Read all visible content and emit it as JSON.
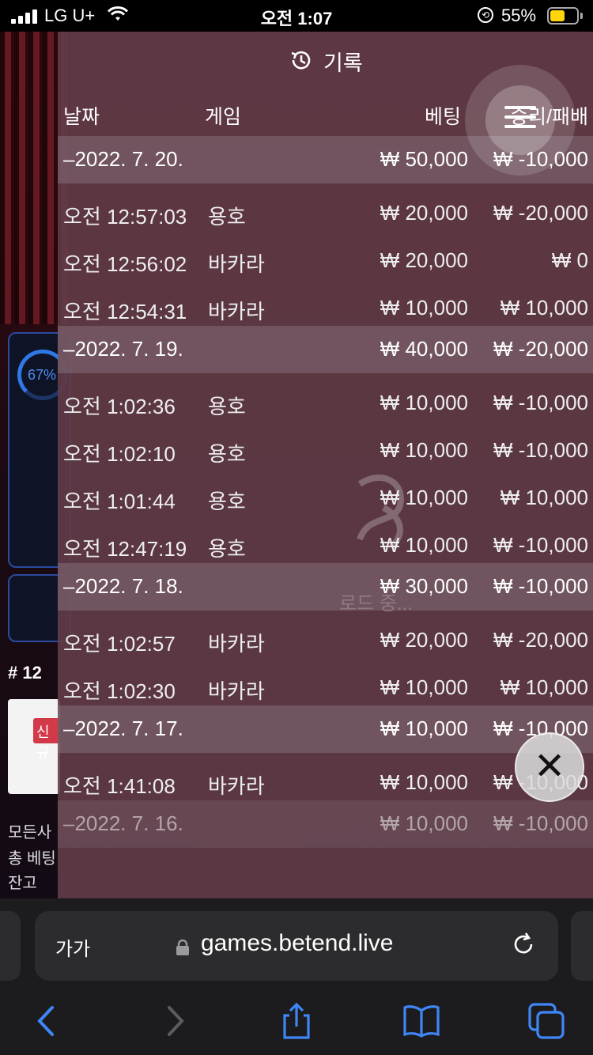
{
  "status_bar": {
    "carrier": "LG U+",
    "time": "오전 1:07",
    "battery": "55%"
  },
  "background": {
    "progress_percent": "67%",
    "table_number": "# 12",
    "badge": "신규",
    "line1": "모든사",
    "line2": "총 베팅",
    "line3": "잔고"
  },
  "history": {
    "title": "기록",
    "columns": {
      "date": "날짜",
      "game": "게임",
      "bet": "베팅",
      "win_loss": "승리/패배"
    },
    "groups": [
      {
        "date": "–2022. 7. 20.",
        "bet": "₩ 50,000",
        "result": "₩ -10,000",
        "rows": [
          {
            "time": "오전 12:57:03",
            "game": "용호",
            "bet": "₩ 20,000",
            "result": "₩ -20,000"
          },
          {
            "time": "오전 12:56:02",
            "game": "바카라",
            "bet": "₩ 20,000",
            "result": "₩ 0"
          },
          {
            "time": "오전 12:54:31",
            "game": "바카라",
            "bet": "₩ 10,000",
            "result": "₩ 10,000"
          }
        ]
      },
      {
        "date": "–2022. 7. 19.",
        "bet": "₩ 40,000",
        "result": "₩ -20,000",
        "rows": [
          {
            "time": "오전 1:02:36",
            "game": "용호",
            "bet": "₩ 10,000",
            "result": "₩ -10,000"
          },
          {
            "time": "오전 1:02:10",
            "game": "용호",
            "bet": "₩ 10,000",
            "result": "₩ -10,000"
          },
          {
            "time": "오전 1:01:44",
            "game": "용호",
            "bet": "₩ 10,000",
            "result": "₩ 10,000"
          },
          {
            "time": "오전 12:47:19",
            "game": "용호",
            "bet": "₩ 10,000",
            "result": "₩ -10,000"
          }
        ]
      },
      {
        "date": "–2022. 7. 18.",
        "bet": "₩ 30,000",
        "result": "₩ -10,000",
        "rows": [
          {
            "time": "오전 1:02:57",
            "game": "바카라",
            "bet": "₩ 20,000",
            "result": "₩ -20,000"
          },
          {
            "time": "오전 1:02:30",
            "game": "바카라",
            "bet": "₩ 10,000",
            "result": "₩ 10,000"
          }
        ]
      },
      {
        "date": "–2022. 7. 17.",
        "bet": "₩ 10,000",
        "result": "₩ -10,000",
        "rows": [
          {
            "time": "오전 1:41:08",
            "game": "바카라",
            "bet": "₩ 10,000",
            "result": "₩ -10,000"
          }
        ]
      },
      {
        "date": "–2022. 7. 16.",
        "bet": "₩ 10,000",
        "result": "₩ -10,000",
        "rows": []
      }
    ],
    "loading_text": "로드 중..."
  },
  "safari": {
    "text_size_button": "가가",
    "url": "games.betend.live"
  },
  "icons": {
    "menu": "menu-icon",
    "close": "close-icon",
    "history": "history-clock-icon"
  }
}
